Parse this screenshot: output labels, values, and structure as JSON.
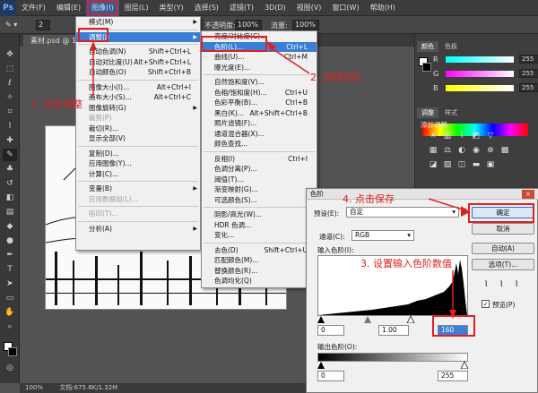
{
  "menubar": {
    "logo": "Ps",
    "items": [
      "文件(F)",
      "编辑(E)",
      "图像(I)",
      "图层(L)",
      "类型(Y)",
      "选择(S)",
      "滤镜(T)",
      "3D(D)",
      "视图(V)",
      "窗口(W)",
      "帮助(H)"
    ]
  },
  "optbar": {
    "size_value": "2",
    "opacity_label": "不透明度:",
    "opacity_value": "100%",
    "flow_label": "流量:",
    "flow_value": "100%"
  },
  "document": {
    "tab_title": "素材.psd @ 100%"
  },
  "status": {
    "zoom": "100%",
    "doc_info": "文档:675.8K/1.32M"
  },
  "image_menu": {
    "items": [
      {
        "label": "模式(M)",
        "sc": "",
        "sub": true
      },
      {
        "sep": true
      },
      {
        "label": "调整(J)",
        "sc": "",
        "sub": true,
        "selected": true
      },
      {
        "sep": true
      },
      {
        "label": "自动色调(N)",
        "sc": "Shift+Ctrl+L"
      },
      {
        "label": "自动对比度(U)",
        "sc": "Alt+Shift+Ctrl+L"
      },
      {
        "label": "自动颜色(O)",
        "sc": "Shift+Ctrl+B"
      },
      {
        "sep": true
      },
      {
        "label": "图像大小(I)...",
        "sc": "Alt+Ctrl+I"
      },
      {
        "label": "画布大小(S)...",
        "sc": "Alt+Ctrl+C"
      },
      {
        "label": "图像旋转(G)",
        "sc": "",
        "sub": true
      },
      {
        "label": "裁剪(P)",
        "sc": "",
        "disabled": true
      },
      {
        "label": "裁切(R)...",
        "sc": ""
      },
      {
        "label": "显示全部(V)",
        "sc": ""
      },
      {
        "sep": true
      },
      {
        "label": "复制(D)...",
        "sc": ""
      },
      {
        "label": "应用图像(Y)...",
        "sc": ""
      },
      {
        "label": "计算(C)...",
        "sc": ""
      },
      {
        "sep": true
      },
      {
        "label": "变量(B)",
        "sc": "",
        "sub": true
      },
      {
        "label": "应用数据组(L)...",
        "sc": "",
        "disabled": true
      },
      {
        "sep": true
      },
      {
        "label": "陷印(T)...",
        "sc": "",
        "disabled": true
      },
      {
        "sep": true
      },
      {
        "label": "分析(A)",
        "sc": "",
        "sub": true
      }
    ]
  },
  "adjust_menu": {
    "items": [
      {
        "label": "亮度/对比度(C)...",
        "sc": ""
      },
      {
        "label": "色阶(L)...",
        "sc": "Ctrl+L",
        "selected": true
      },
      {
        "label": "曲线(U)...",
        "sc": "Ctrl+M"
      },
      {
        "label": "曝光度(E)...",
        "sc": ""
      },
      {
        "sep": true
      },
      {
        "label": "自然饱和度(V)...",
        "sc": ""
      },
      {
        "label": "色相/饱和度(H)...",
        "sc": "Ctrl+U"
      },
      {
        "label": "色彩平衡(B)...",
        "sc": "Ctrl+B"
      },
      {
        "label": "黑白(K)...",
        "sc": "Alt+Shift+Ctrl+B"
      },
      {
        "label": "照片滤镜(F)...",
        "sc": ""
      },
      {
        "label": "通道混合器(X)...",
        "sc": ""
      },
      {
        "label": "颜色查找...",
        "sc": ""
      },
      {
        "sep": true
      },
      {
        "label": "反相(I)",
        "sc": "Ctrl+I"
      },
      {
        "label": "色调分离(P)...",
        "sc": ""
      },
      {
        "label": "阈值(T)...",
        "sc": ""
      },
      {
        "label": "渐变映射(G)...",
        "sc": ""
      },
      {
        "label": "可选颜色(S)...",
        "sc": ""
      },
      {
        "sep": true
      },
      {
        "label": "阴影/高光(W)...",
        "sc": ""
      },
      {
        "label": "HDR 色调...",
        "sc": ""
      },
      {
        "label": "变化...",
        "sc": ""
      },
      {
        "sep": true
      },
      {
        "label": "去色(D)",
        "sc": "Shift+Ctrl+U"
      },
      {
        "label": "匹配颜色(M)...",
        "sc": ""
      },
      {
        "label": "替换颜色(R)...",
        "sc": ""
      },
      {
        "label": "色调均化(Q)",
        "sc": ""
      }
    ]
  },
  "panels": {
    "color_tabs": [
      "颜色",
      "色板"
    ],
    "rgb": [
      {
        "ch": "R",
        "val": "255"
      },
      {
        "ch": "G",
        "val": "255"
      },
      {
        "ch": "B",
        "val": "255"
      }
    ],
    "adj_tabs": [
      "调整",
      "样式"
    ],
    "adj_title": "添加调整"
  },
  "levels_dialog": {
    "title": "色阶",
    "close": "×",
    "preset_label": "预设(E):",
    "preset_value": "自定",
    "channel_label": "通道(C):",
    "channel_value": "RGB",
    "input_label": "输入色阶(I):",
    "input_black": "0",
    "input_gamma": "1.00",
    "input_white": "160",
    "output_label": "输出色阶(O):",
    "output_black": "0",
    "output_white": "255",
    "buttons": {
      "ok": "确定",
      "cancel": "取消",
      "auto": "自动(A)",
      "options": "选项(T)..."
    },
    "preview_label": "预览(P)",
    "preview_checked": true
  },
  "annotations": {
    "step1": "1. 点击调整",
    "step2": "2. 选择色阶",
    "step3": "3. 设置输入色阶数值",
    "step4": "4. 点击保存"
  },
  "colors": {
    "annotation": "#e02020",
    "menu_highlight": "#3a7fd5"
  }
}
